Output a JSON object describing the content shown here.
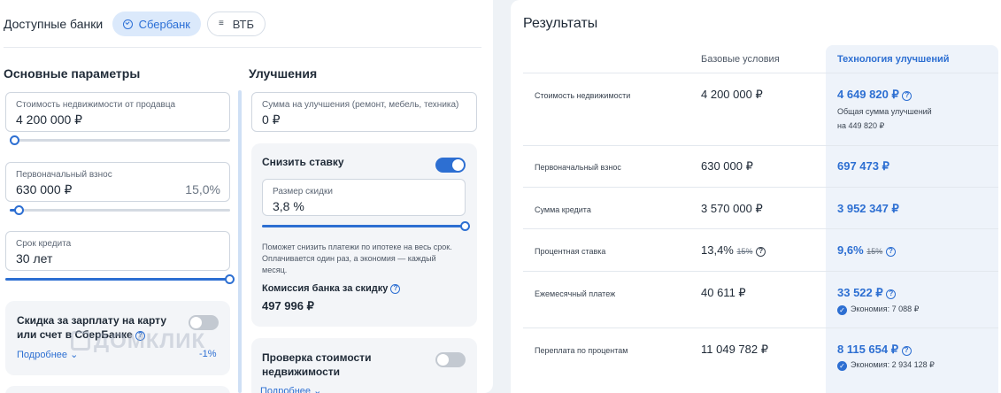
{
  "banks": {
    "label": "Доступные банки",
    "items": [
      {
        "name": "Сбербанк",
        "selected": true
      },
      {
        "name": "ВТБ",
        "selected": false
      }
    ]
  },
  "main_params": {
    "title": "Основные параметры",
    "price": {
      "label": "Стоимость недвижимости от продавца",
      "value": "4 200 000 ₽",
      "slider_level": 0.03
    },
    "down_payment": {
      "label": "Первоначальный взнос",
      "value": "630 000 ₽",
      "percent": "15,0%",
      "slider_level": 0.05
    },
    "term": {
      "label": "Срок кредита",
      "value": "30 лет",
      "slider_level": 1.0
    },
    "salary_discount": {
      "title": "Скидка за зарплату на карту или счет в СберБанке",
      "toggle_on": false,
      "more_link": "Подробнее",
      "value": "-1%"
    }
  },
  "improvements": {
    "title": "Улучшения",
    "amount": {
      "label": "Сумма на улучшения (ремонт, мебель, техника)",
      "value": "0 ₽"
    },
    "reduce_rate": {
      "title": "Снизить ставку",
      "toggle_on": true,
      "discount_label": "Размер скидки",
      "discount_value": "3,8 %",
      "slider_level": 1.0,
      "note": "Поможет снизить платежи по ипотеке на весь срок. Оплачивается один раз, а экономия — каждый месяц.",
      "fee_label": "Комиссия банка за скидку",
      "fee_value": "497 996 ₽"
    },
    "check_value": {
      "title": "Проверка стоимости недвижимости",
      "toggle_on": false,
      "more_link": "Подробнее"
    }
  },
  "watermark": "ДОМКЛИК",
  "results": {
    "title": "Результаты",
    "col_base": "Базовые условия",
    "col_tech": "Технология улучшений",
    "rows": [
      {
        "label": "Стоимость недвижимости",
        "base": "4 200 000 ₽",
        "tech": "4 649 820 ₽",
        "tech_note1": "Общая сумма улучшений",
        "tech_note2": "на 449 820 ₽"
      },
      {
        "label": "Первоначальный взнос",
        "base": "630 000 ₽",
        "tech": "697 473 ₽"
      },
      {
        "label": "Сумма кредита",
        "base": "3 570 000 ₽",
        "tech": "3 952 347 ₽"
      },
      {
        "label": "Процентная ставка",
        "base": "13,4%",
        "base_old": "15%",
        "tech": "9,6%",
        "tech_old": "15%"
      },
      {
        "label": "Ежемесячный платеж",
        "base": "40 611 ₽",
        "tech": "33 522 ₽",
        "saving": "Экономия: 7 088 ₽"
      },
      {
        "label": "Переплата по процентам",
        "base": "11 049 782 ₽",
        "tech": "8 115 654 ₽",
        "saving": "Экономия: 2 934 128 ₽"
      }
    ]
  },
  "colors": {
    "accent": "#2d6fd2",
    "chip_selected_bg": "#dbe9fb",
    "tech_col_bg": "#eef3fa"
  }
}
